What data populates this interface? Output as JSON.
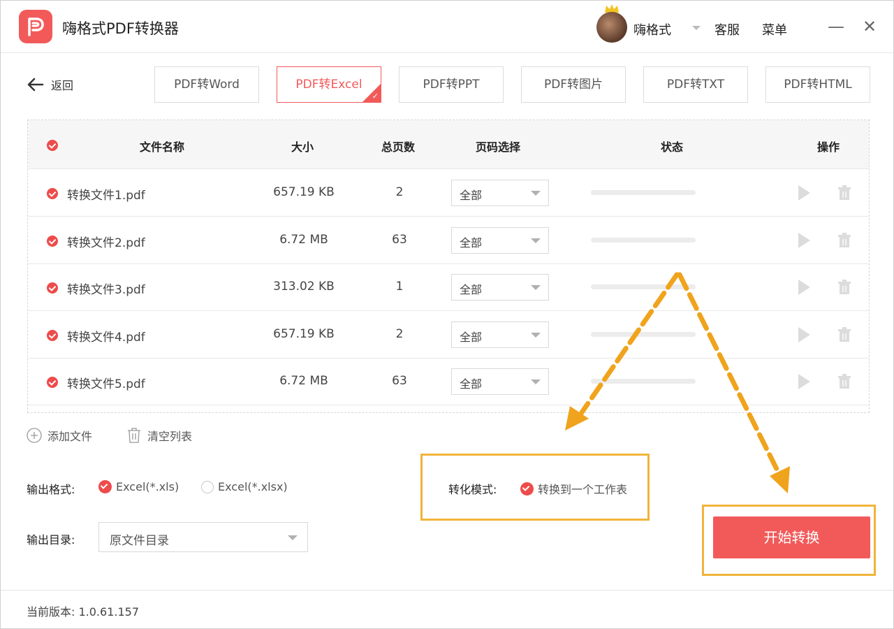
{
  "app": {
    "title": "嗨格式PDF转换器",
    "brand_color": "#f25a5a"
  },
  "header": {
    "user_name": "嗨格式",
    "service_label": "客服",
    "menu_label": "菜单",
    "minimize_symbol": "—",
    "close_symbol": "✕"
  },
  "nav": {
    "back_label": "返回",
    "tabs": [
      {
        "label": "PDF转Word",
        "active": false
      },
      {
        "label": "PDF转Excel",
        "active": true
      },
      {
        "label": "PDF转PPT",
        "active": false
      },
      {
        "label": "PDF转图片",
        "active": false
      },
      {
        "label": "PDF转TXT",
        "active": false
      },
      {
        "label": "PDF转HTML",
        "active": false
      }
    ]
  },
  "table": {
    "columns": {
      "name": "文件名称",
      "size": "大小",
      "pages": "总页数",
      "page_select": "页码选择",
      "status": "状态",
      "actions": "操作"
    },
    "rows": [
      {
        "name": "转换文件1.pdf",
        "size": "657.19 KB",
        "pages": "2",
        "page_select": "全部",
        "progress": 0
      },
      {
        "name": "转换文件2.pdf",
        "size": "6.72 MB",
        "pages": "63",
        "page_select": "全部",
        "progress": 0
      },
      {
        "name": "转换文件3.pdf",
        "size": "313.02 KB",
        "pages": "1",
        "page_select": "全部",
        "progress": 0
      },
      {
        "name": "转换文件4.pdf",
        "size": "657.19 KB",
        "pages": "2",
        "page_select": "全部",
        "progress": 0
      },
      {
        "name": "转换文件5.pdf",
        "size": "6.72 MB",
        "pages": "63",
        "page_select": "全部",
        "progress": 0
      }
    ]
  },
  "list_actions": {
    "add_file": "添加文件",
    "clear_list": "清空列表"
  },
  "output": {
    "format_label": "输出格式:",
    "format_options": [
      {
        "label": "Excel(*.xls)",
        "selected": true
      },
      {
        "label": "Excel(*.xlsx)",
        "selected": false
      }
    ],
    "dir_label": "输出目录:",
    "dir_value": "原文件目录"
  },
  "mode": {
    "label": "转化模式:",
    "option": "转换到一个工作表",
    "checked": true
  },
  "start_button": "开始转换",
  "footer": {
    "version": "当前版本: 1.0.61.157"
  },
  "annotation": {
    "highlight_color": "#f0b43a",
    "arrow_color": "#f0a31c"
  }
}
